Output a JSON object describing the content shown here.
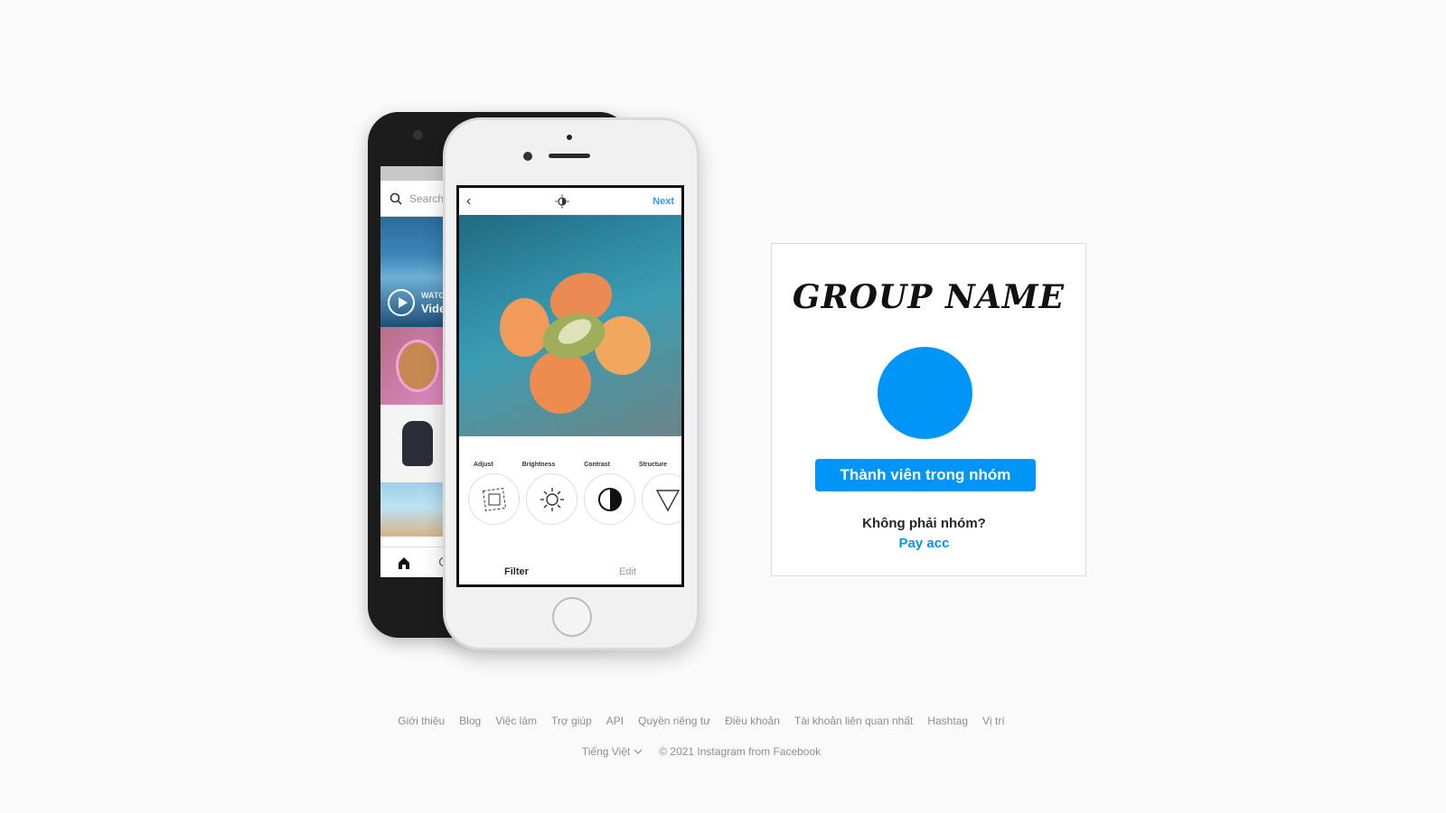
{
  "phones": {
    "back_search_placeholder": "Search",
    "back_tile_watch": "WATCH",
    "back_tile_video": "Video",
    "front_next": "Next",
    "tools": [
      "Adjust",
      "Brightness",
      "Contrast",
      "Structure"
    ],
    "tab_filter": "Filter",
    "tab_edit": "Edit"
  },
  "card": {
    "group_name": "GROUP NAME",
    "members_button": "Thành viên trong nhóm",
    "not_group_text": "Không phải nhóm?",
    "pay_link": "Pay acc",
    "accent_color": "#0095f6"
  },
  "footer": {
    "links": [
      "Giới thiệu",
      "Blog",
      "Việc làm",
      "Trợ giúp",
      "API",
      "Quyền riêng tư",
      "Điều khoản",
      "Tài khoản liên quan nhất",
      "Hashtag",
      "Vị trí"
    ],
    "language": "Tiếng Việt",
    "copyright": "© 2021 Instagram from Facebook"
  }
}
